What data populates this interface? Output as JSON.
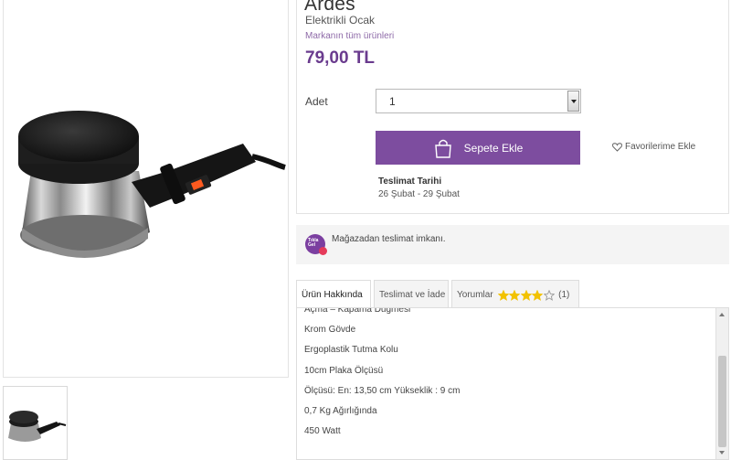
{
  "product": {
    "brand": "Ardes",
    "subtitle": "Elektrikli Ocak",
    "brand_link": "Markanın tüm ürünleri",
    "price": "79,00 TL"
  },
  "purchase": {
    "quantity_label": "Adet",
    "quantity_value": "1",
    "add_to_cart": "Sepete Ekle",
    "favorites": "Favorilerime Ekle",
    "delivery_title": "Teslimat Tarihi",
    "delivery_range": "26 Şubat - 29 Şubat"
  },
  "store_banner": {
    "logo_text": "Tıkla Gel",
    "text": "Mağazadan teslimat imkanı."
  },
  "tabs": {
    "about": "Ürün Hakkında",
    "delivery_return": "Teslimat ve İade",
    "reviews": "Yorumlar",
    "review_rating": 4,
    "review_rating_max": 5,
    "review_count": "(1)"
  },
  "specs": [
    "Açma – Kapama Düğmesi",
    "Krom Gövde",
    "Ergoplastik Tutma Kolu",
    "10cm Plaka Ölçüsü",
    "Ölçüsü: En: 13,50 cm Yükseklik : 9 cm",
    "0,7 Kg Ağırlığında",
    "450 Watt"
  ],
  "colors": {
    "accent": "#7d4d9f",
    "price": "#6a3b8e",
    "star": "#f2c200"
  }
}
